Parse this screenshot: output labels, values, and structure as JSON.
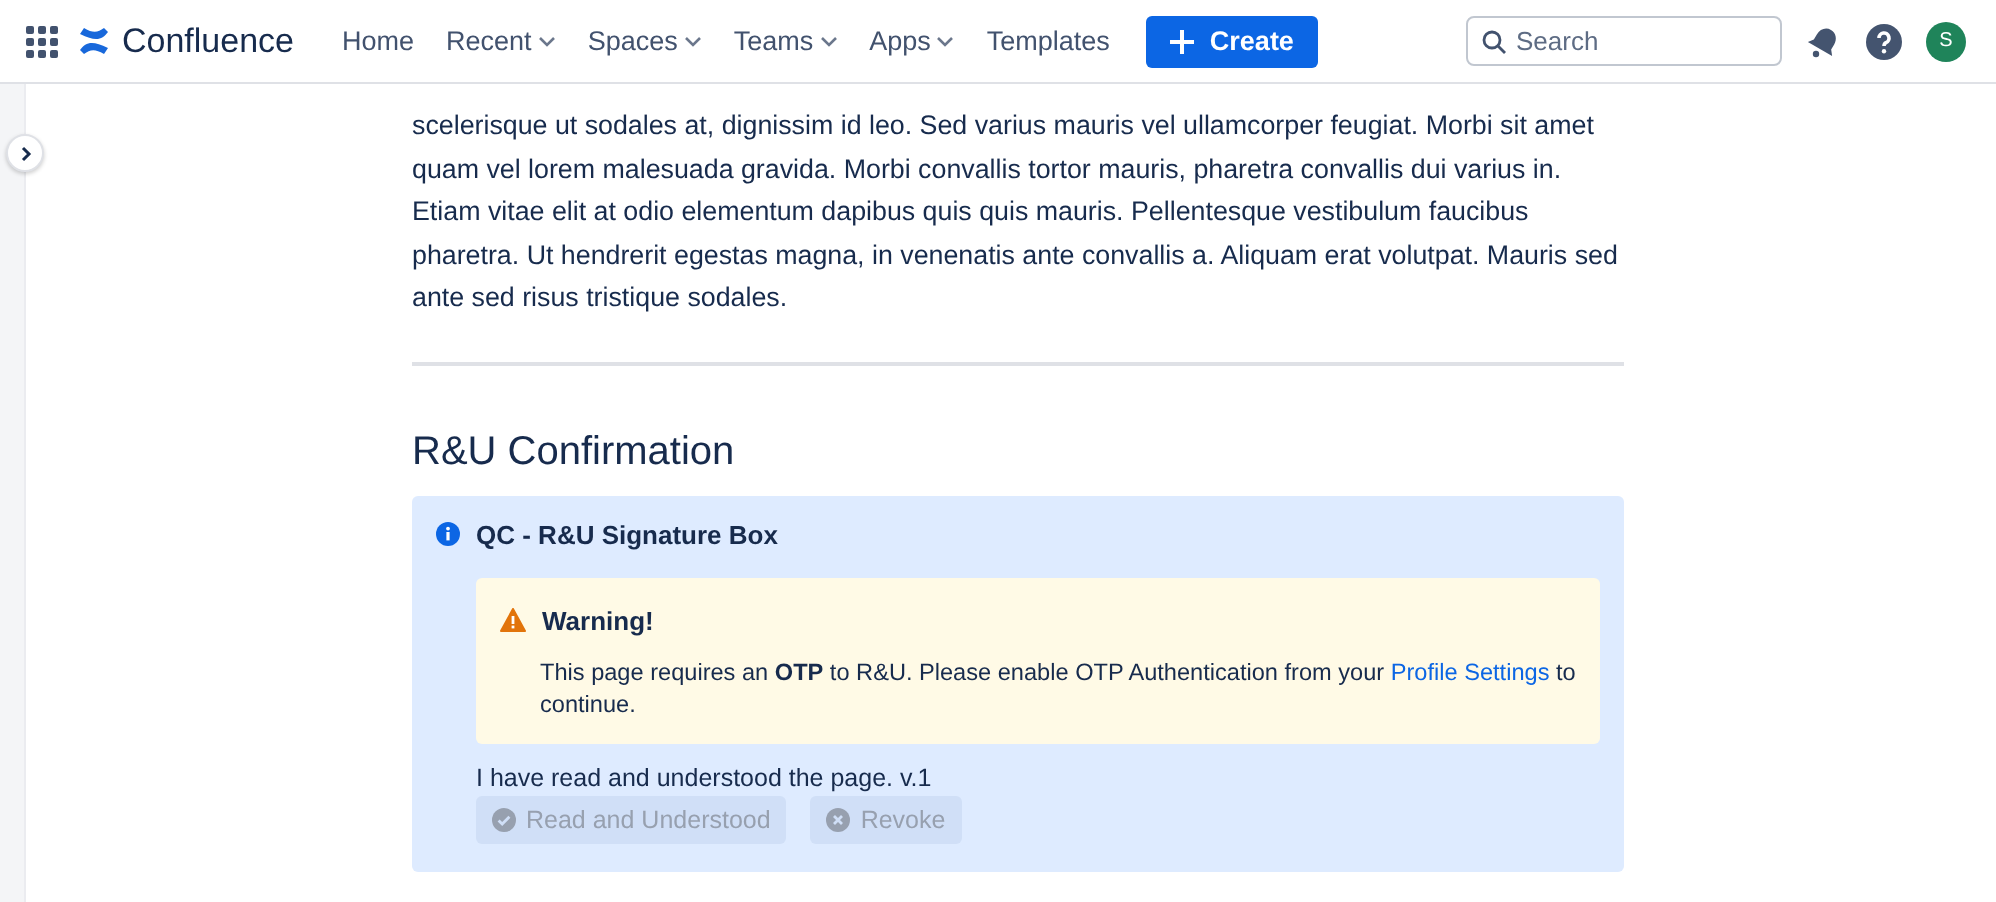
{
  "nav": {
    "product": "Confluence",
    "items": [
      {
        "label": "Home",
        "dropdown": false
      },
      {
        "label": "Recent",
        "dropdown": true
      },
      {
        "label": "Spaces",
        "dropdown": true
      },
      {
        "label": "Teams",
        "dropdown": true
      },
      {
        "label": "Apps",
        "dropdown": true
      },
      {
        "label": "Templates",
        "dropdown": false
      }
    ],
    "create": "Create",
    "search": {
      "placeholder": "Search"
    },
    "avatar": "S"
  },
  "body": {
    "paragraph": "scelerisque ut sodales at, dignissim id leo. Sed varius mauris vel ullamcorper feugiat. Morbi sit amet quam vel lorem malesuada gravida. Morbi convallis tortor mauris, pharetra convallis dui varius in. Etiam vitae elit at odio elementum dapibus quis quis mauris. Pellentesque vestibulum faucibus pharetra. Ut hendrerit egestas magna, in venenatis ante convallis a. Aliquam erat volutpat. Mauris sed ante sed risus tristique sodales.",
    "heading": "R&U Confirmation"
  },
  "panel": {
    "title": "QC - R&U Signature Box",
    "warning": {
      "title": "Warning!",
      "text": "This page requires an **OTP** to R&U. Please enable OTP Authentication from your",
      "link": "Profile Settings",
      "text_after": "to continue."
    },
    "statement": "I have read and understood the page. v.1",
    "buttons": [
      {
        "kind": "confirm",
        "label": "Read and Understood",
        "disabled": true
      },
      {
        "kind": "revoke",
        "label": "Revoke",
        "disabled": true
      }
    ]
  }
}
